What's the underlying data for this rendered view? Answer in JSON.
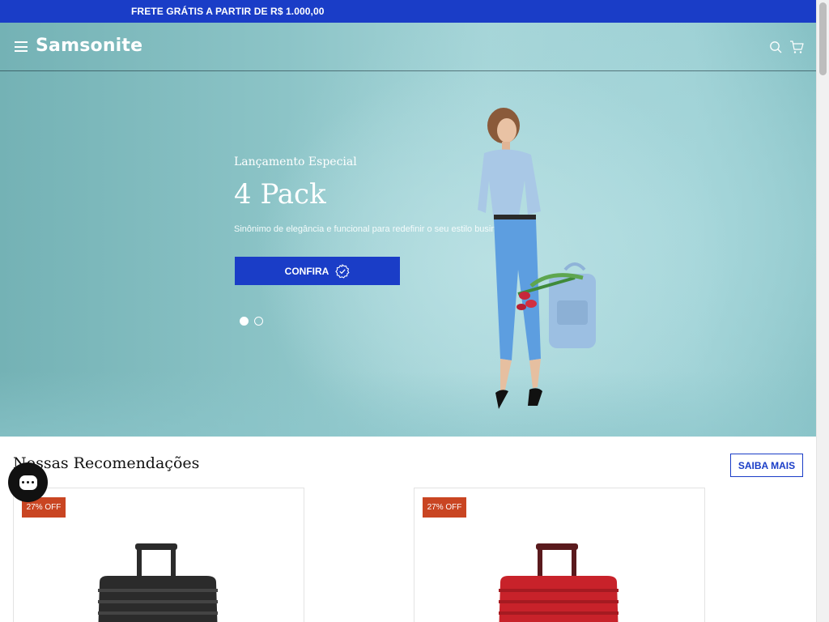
{
  "promo_bar": {
    "text": "FRETE GRÁTIS A PARTIR DE R$ 1.000,00"
  },
  "header": {
    "logo_text": "Samsonite",
    "icons": [
      "menu-icon",
      "search-icon",
      "cart-icon"
    ]
  },
  "hero": {
    "eyebrow": "Lançamento Especial",
    "title": "4 Pack",
    "description": "Sinônimo de elegância e funcional para redefinir o seu estilo business.",
    "cta_label": "CONFIRA",
    "carousel": {
      "slides": 2,
      "active": 1
    }
  },
  "recommendations": {
    "title": "Nossas Recomendações",
    "saiba_mais_label": "SAIBA MAIS",
    "products": [
      {
        "badge": "27% OFF",
        "color_name": "black",
        "color": "#2b2b2b"
      },
      {
        "badge": "27% OFF",
        "color_name": "red",
        "color": "#c8222a"
      }
    ]
  },
  "colors": {
    "brand_blue": "#1a3dc7",
    "badge_orange": "#c94522",
    "hero_teal": "#9dd0d4"
  }
}
